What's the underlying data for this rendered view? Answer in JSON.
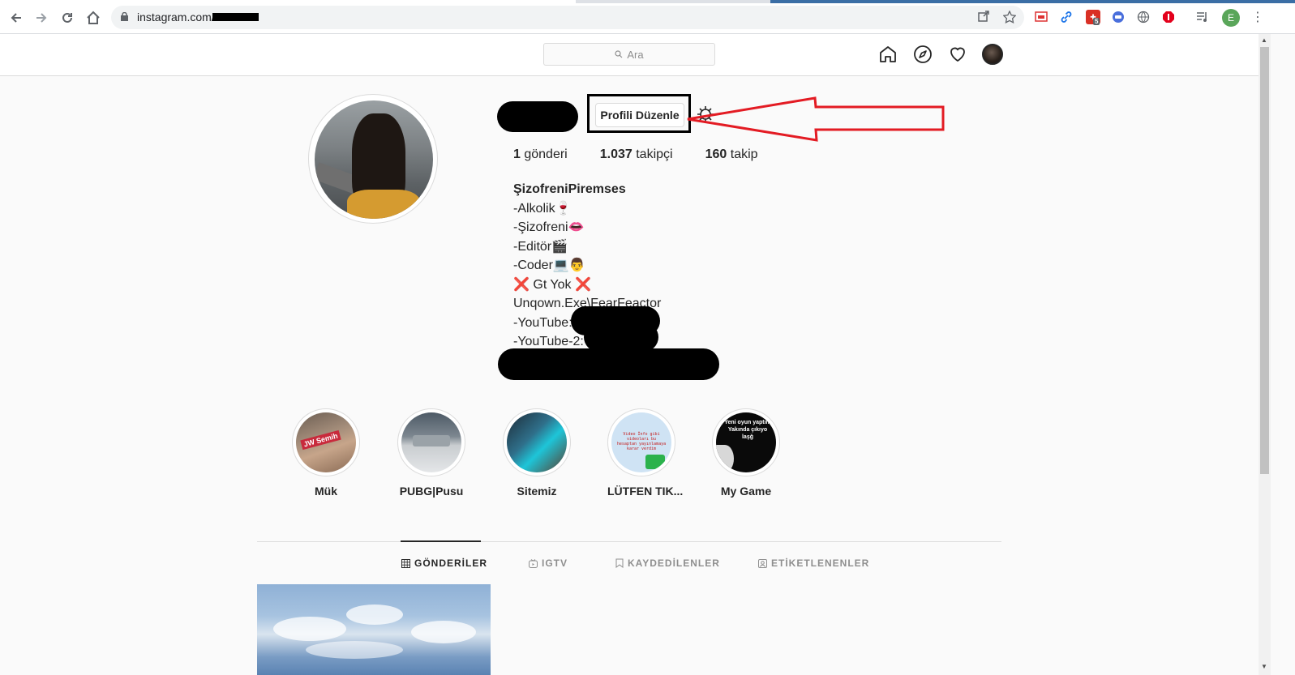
{
  "browser": {
    "url": "instagram.com/",
    "extension_badge": "5",
    "profile_initial": "E"
  },
  "header": {
    "search_placeholder": "Ara"
  },
  "profile": {
    "edit_button": "Profili Düzenle",
    "stats": {
      "posts_count": "1",
      "posts_label": "gönderi",
      "followers_count": "1.037",
      "followers_label": "takipçi",
      "following_count": "160",
      "following_label": "takip"
    },
    "bio": {
      "name": "ŞizofreniPiremses",
      "lines": [
        "-Alkolik🍷",
        "-Şizofreni👄",
        "-Editör🎬",
        "-Coder💻👨",
        "❌ Gt Yok ❌",
        "Unqown.Exe\\FearFeactor",
        "-YouTube:",
        "-YouTube-2:"
      ]
    }
  },
  "highlights": [
    {
      "label": "Mük",
      "overlay_text": "JW Semih"
    },
    {
      "label": "PUBG|Pusu",
      "overlay_text": ""
    },
    {
      "label": "Sitemiz",
      "overlay_text": ""
    },
    {
      "label": "LÜTFEN TIK...",
      "overlay_text": "Video İnfo gibi videoları bu hesaptan yayınlamaya karar verdim"
    },
    {
      "label": "My Game",
      "overlay_text": "Yeni oyun yaptım Yakında çıkıyo laşğ"
    }
  ],
  "tabs": [
    {
      "label": "GÖNDERİLER",
      "active": true
    },
    {
      "label": "IGTV",
      "active": false
    },
    {
      "label": "KAYDEDİLENLER",
      "active": false
    },
    {
      "label": "ETİKETLENENLER",
      "active": false
    }
  ],
  "colors": {
    "annotation_red": "#e31b23",
    "text_primary": "#262626",
    "text_secondary": "#8e8e8e",
    "border": "#dbdbdb"
  }
}
